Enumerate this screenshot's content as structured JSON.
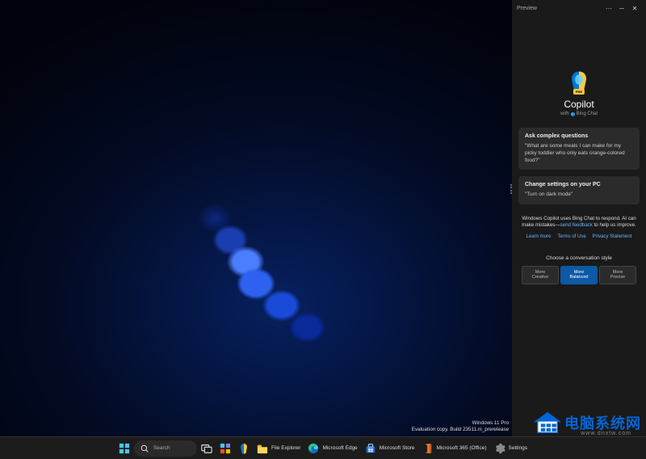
{
  "copilot": {
    "titlebar": "Preview",
    "logo_title": "Copilot",
    "logo_sub_prefix": "with",
    "logo_sub_brand": "Bing Chat",
    "pre_badge": "PRE",
    "cards": [
      {
        "heading": "Ask complex questions",
        "body": "\"What are some meals I can make for my picky toddler who only eats orange-colored food?\""
      },
      {
        "heading": "Change settings on your PC",
        "body": "\"Turn on dark mode\""
      }
    ],
    "disclaimer_a": "Windows Copilot uses Bing Chat to respond. AI can make mistakes—",
    "disclaimer_link": "send feedback",
    "disclaimer_b": " to help us improve.",
    "legal": [
      "Learn more",
      "Terms of Use",
      "Privacy Statement"
    ],
    "style_label": "Choose a conversation style",
    "styles": [
      {
        "l1": "More",
        "l2": "Creative",
        "selected": false
      },
      {
        "l1": "More",
        "l2": "Balanced",
        "selected": true
      },
      {
        "l1": "More",
        "l2": "Precise",
        "selected": false
      }
    ]
  },
  "taskbar": {
    "search": "Search",
    "items": [
      {
        "name": "start",
        "label": "",
        "icon": "win"
      },
      {
        "name": "search",
        "label": "Search",
        "icon": "search"
      },
      {
        "name": "task-view",
        "label": "",
        "icon": "taskview"
      },
      {
        "name": "widgets",
        "label": "",
        "icon": "widgets"
      },
      {
        "name": "copilot",
        "label": "",
        "icon": "copilot"
      },
      {
        "name": "file-explorer",
        "label": "File Explorer",
        "icon": "explorer"
      },
      {
        "name": "microsoft-edge",
        "label": "Microsoft Edge",
        "icon": "edge"
      },
      {
        "name": "microsoft-store",
        "label": "Microsoft Store",
        "icon": "store"
      },
      {
        "name": "m365",
        "label": "Microsoft 365 (Office)",
        "icon": "m365"
      },
      {
        "name": "settings",
        "label": "Settings",
        "icon": "settings"
      }
    ]
  },
  "evaluation": {
    "line1": "Windows 11 Pro",
    "line2": "Evaluation copy. Build 23511.ni_prerelease"
  },
  "watermark": {
    "cn": "电脑系统网",
    "domain": "www.dnxtw.com"
  },
  "colors": {
    "accent": "#0c5aa6",
    "panel": "#1a1a1a",
    "card": "#2b2b2b"
  }
}
